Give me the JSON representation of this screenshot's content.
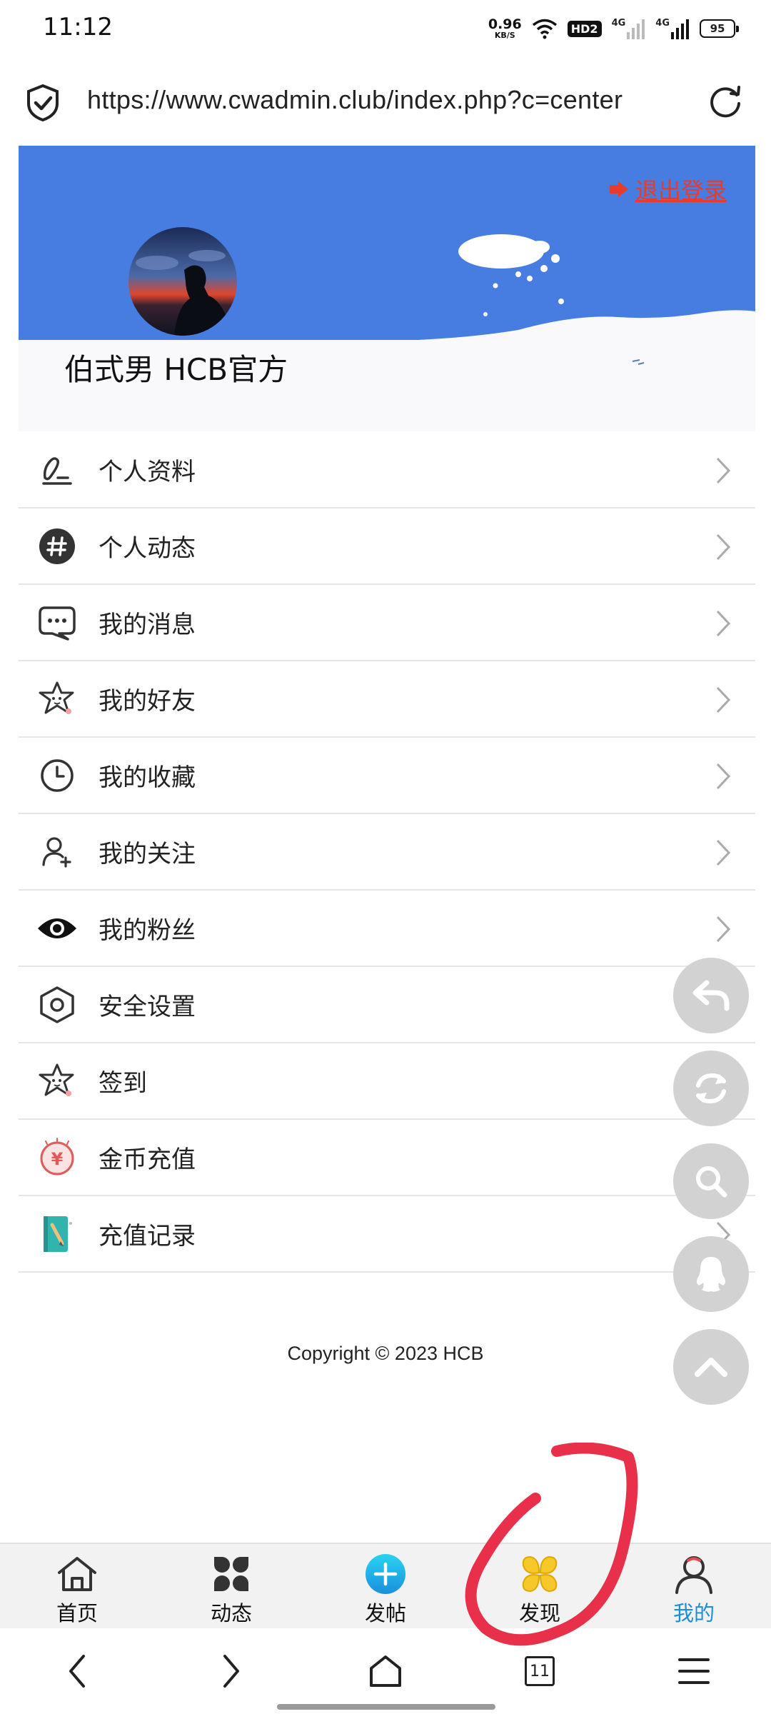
{
  "status_bar": {
    "time": "11:12",
    "net_speed": "0.96",
    "net_unit": "KB/S",
    "hd": "HD2",
    "network_1": "4G",
    "network_2": "4G",
    "battery": "95"
  },
  "url_bar": {
    "url": "https://www.cwadmin.club/index.php?c=center"
  },
  "profile": {
    "logout_label": "退出登录",
    "username": "伯式男  HCB官方",
    "banner_color": "#477de0"
  },
  "menu": {
    "items": [
      {
        "label": "个人资料",
        "icon": "edit-icon"
      },
      {
        "label": "个人动态",
        "icon": "hashtag-icon"
      },
      {
        "label": "我的消息",
        "icon": "message-icon"
      },
      {
        "label": "我的好友",
        "icon": "star-face-icon"
      },
      {
        "label": "我的收藏",
        "icon": "clock-icon"
      },
      {
        "label": "我的关注",
        "icon": "user-plus-icon"
      },
      {
        "label": "我的粉丝",
        "icon": "eye-icon"
      },
      {
        "label": "安全设置",
        "icon": "hexagon-settings-icon"
      },
      {
        "label": "签到",
        "icon": "star-face-icon"
      },
      {
        "label": "金币充值",
        "icon": "coin-icon"
      },
      {
        "label": "充值记录",
        "icon": "notebook-icon"
      }
    ]
  },
  "footer": {
    "copyright": "Copyright © 2023 HCB"
  },
  "floating_buttons": [
    "back-icon",
    "refresh-icon",
    "search-icon",
    "qq-icon",
    "scroll-top-icon"
  ],
  "bottom_nav": {
    "home": "首页",
    "feed": "动态",
    "post": "发帖",
    "discover": "发现",
    "mine": "我的"
  },
  "browser_nav": {
    "tab_count": "11"
  },
  "colors": {
    "accent": "#1a8fde",
    "logout": "#e53c2e",
    "annotation": "#e8304a"
  }
}
